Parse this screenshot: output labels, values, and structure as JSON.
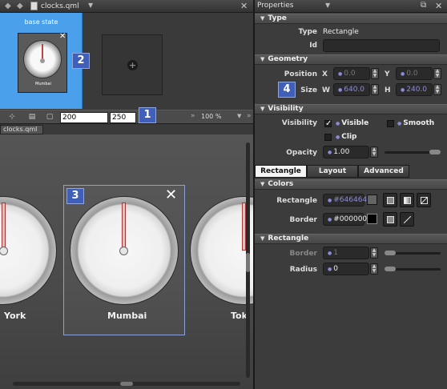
{
  "editor": {
    "file_name": "clocks.qml",
    "nav_back": "◆",
    "nav_fwd": "◆",
    "close": "✕",
    "dropdown": "▼"
  },
  "states": {
    "base_state_label": "base state",
    "thumb_city": "Mumbai",
    "thumb_close": "✕",
    "add_icon": "+"
  },
  "toolbar": {
    "width_value": "200",
    "height_value": "250",
    "zoom": "100 %",
    "more": "»",
    "more2": "»",
    "zoom_dropdown": "▼"
  },
  "canvas": {
    "tab_label": "clocks.qml",
    "cities": [
      "York",
      "Mumbai",
      "Tok"
    ],
    "remove_icon": "✕"
  },
  "callouts": [
    "1",
    "2",
    "3",
    "4"
  ],
  "properties": {
    "title": "Properties",
    "dropdown": "▼",
    "float_icon": "⧉",
    "close": "✕",
    "type_section": {
      "header": "Type",
      "type_label": "Type",
      "type_value": "Rectangle",
      "id_label": "Id",
      "id_value": ""
    },
    "geometry_section": {
      "header": "Geometry",
      "position_label": "Position",
      "x_label": "X",
      "x_value": "0.0",
      "y_label": "Y",
      "y_value": "0.0",
      "size_label": "Size",
      "w_label": "W",
      "w_value": "640.0",
      "h_label": "H",
      "h_value": "240.0"
    },
    "visibility_section": {
      "header": "Visibility",
      "visibility_label": "Visibility",
      "visible_label": "Visible",
      "visible_checked": true,
      "smooth_label": "Smooth",
      "smooth_checked": false,
      "clip_label": "Clip",
      "clip_checked": false,
      "opacity_label": "Opacity",
      "opacity_value": "1.00",
      "opacity_level": 1.0
    },
    "tabs": [
      "Rectangle",
      "Layout",
      "Advanced"
    ],
    "active_tab": "Rectangle",
    "colors_section": {
      "header": "Colors",
      "rectangle_label": "Rectangle",
      "rectangle_value": "#646464",
      "rectangle_color": "#646464",
      "border_label": "Border",
      "border_value": "#000000",
      "border_color": "#000000"
    },
    "rectangle_section": {
      "header": "Rectangle",
      "border_label": "Border",
      "border_value": "1",
      "radius_label": "Radius",
      "radius_value": "0"
    }
  },
  "colors": {
    "accent_blue": "#4aa0ea",
    "callout_blue": "#3f5fb8",
    "value_text": "#8b8bd8"
  }
}
